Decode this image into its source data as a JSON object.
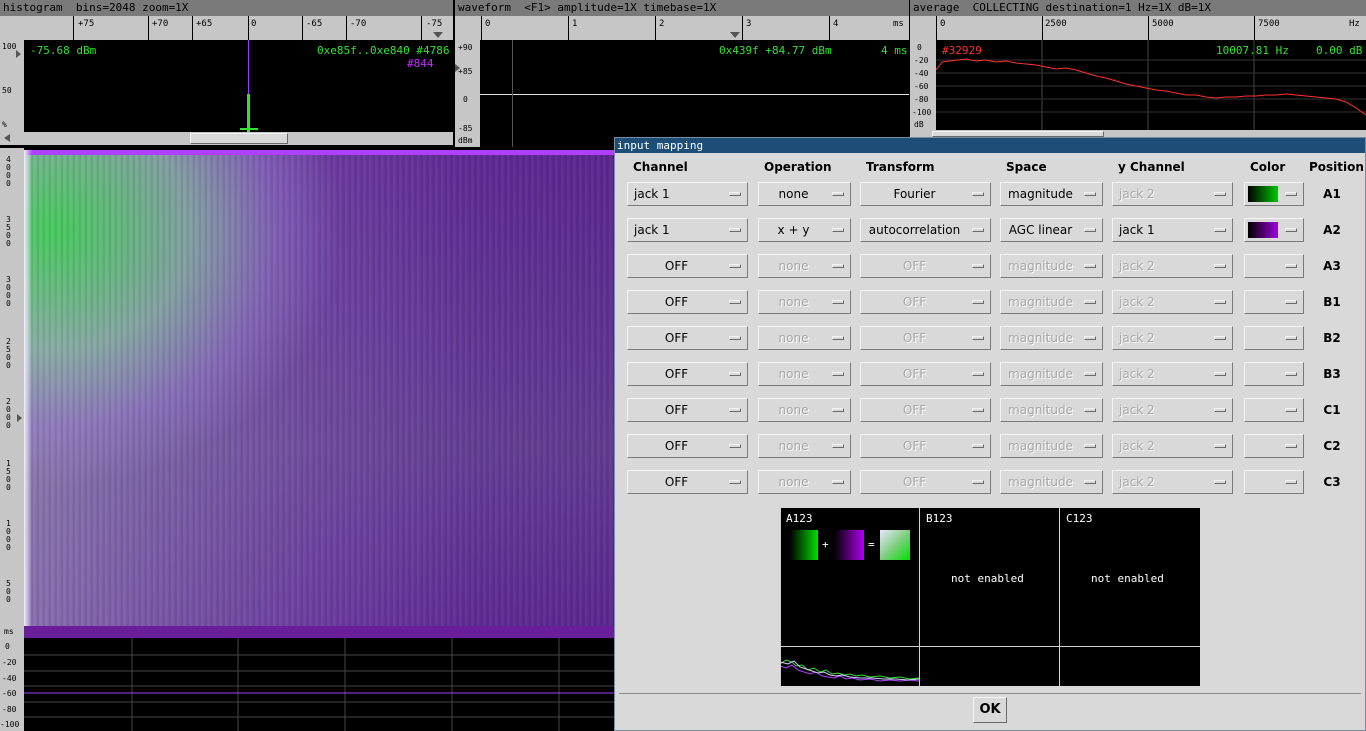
{
  "histogram": {
    "title": "histogram  bins=2048 zoom=1X",
    "ruler_labels": [
      "+75",
      "+70",
      "+65",
      "0",
      "-65",
      "-70",
      "-75"
    ],
    "left_ticks": [
      "100",
      "50",
      "%"
    ],
    "readout_left": "-75.68 dBm",
    "readout_right": "0xe85f..0xe840 #4786",
    "readout_right2": "#844"
  },
  "waveform": {
    "title": "waveform  <F1> amplitude=1X timebase=1X",
    "ruler_labels": [
      "0",
      "1",
      "2",
      "3",
      "4",
      "ms"
    ],
    "left_ticks": [
      "+90",
      "+85",
      "0",
      "-85",
      "dBm"
    ],
    "readout": "0x439f  +84.77 dBm",
    "readout_time": "4 ms"
  },
  "average": {
    "title": "average  COLLECTING destination=1 Hz=1X dB=1X",
    "ruler_labels": [
      "0",
      "2500",
      "5000",
      "7500",
      "Hz"
    ],
    "left_ticks": [
      "0",
      "-20",
      "-40",
      "-60",
      "-80",
      "-100",
      "dB"
    ],
    "readout_left": "#32929",
    "readout_freq": "10007.81 Hz",
    "readout_db": "0.00 dB"
  },
  "spectrogram": {
    "left_ticks": [
      "4\n0\n0\n0",
      "3\n5\n0\n0",
      "3\n0\n0\n0",
      "2\n5\n0\n0",
      "2\n0\n0\n0",
      "1\n5\n0\n0",
      "1\n0\n0\n0",
      "5\n0\n0",
      "ms"
    ],
    "bottom_ticks": [
      "0",
      "-20",
      "-40",
      "-60",
      "-80",
      "-100"
    ]
  },
  "dialog": {
    "title": "input mapping",
    "headers": {
      "channel": "Channel",
      "operation": "Operation",
      "transform": "Transform",
      "space": "Space",
      "ychannel": "y Channel",
      "color": "Color",
      "position": "Position"
    },
    "rows": [
      {
        "channel": "jack 1",
        "operation": "none",
        "transform": "Fourier",
        "space": "magnitude",
        "ychannel": "jack 2",
        "position": "A1"
      },
      {
        "channel": "jack 1",
        "operation": "x + y",
        "transform": "autocorrelation",
        "space": "AGC linear",
        "ychannel": "jack 1",
        "position": "A2"
      },
      {
        "channel": "OFF",
        "operation": "none",
        "transform": "OFF",
        "space": "magnitude",
        "ychannel": "jack 2",
        "position": "A3"
      },
      {
        "channel": "OFF",
        "operation": "none",
        "transform": "OFF",
        "space": "magnitude",
        "ychannel": "jack 2",
        "position": "B1"
      },
      {
        "channel": "OFF",
        "operation": "none",
        "transform": "OFF",
        "space": "magnitude",
        "ychannel": "jack 2",
        "position": "B2"
      },
      {
        "channel": "OFF",
        "operation": "none",
        "transform": "OFF",
        "space": "magnitude",
        "ychannel": "jack 2",
        "position": "B3"
      },
      {
        "channel": "OFF",
        "operation": "none",
        "transform": "OFF",
        "space": "magnitude",
        "ychannel": "jack 2",
        "position": "C1"
      },
      {
        "channel": "OFF",
        "operation": "none",
        "transform": "OFF",
        "space": "magnitude",
        "ychannel": "jack 2",
        "position": "C2"
      },
      {
        "channel": "OFF",
        "operation": "none",
        "transform": "OFF",
        "space": "magnitude",
        "ychannel": "jack 2",
        "position": "C3"
      }
    ],
    "colors": {
      "a1": "#00c800",
      "a2": "#a000e0"
    },
    "preview": {
      "a_label": "A123",
      "plus": "+",
      "equals": "=",
      "b_label": "B123",
      "b_text": "not enabled",
      "c_label": "C123",
      "c_text": "not enabled"
    },
    "ok_label": "OK"
  }
}
